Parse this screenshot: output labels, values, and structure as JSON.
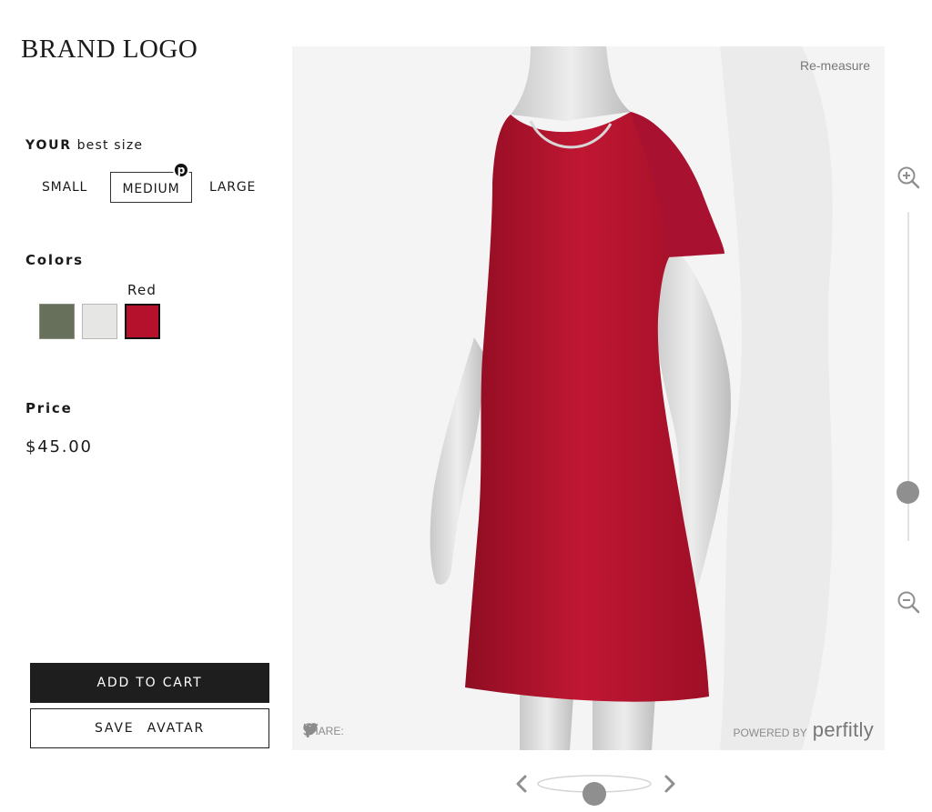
{
  "brand": {
    "logo_text": "BRAND LOGO"
  },
  "size": {
    "heading_bold": "YOUR",
    "heading_rest": "best size",
    "options": [
      "SMALL",
      "MEDIUM",
      "LARGE"
    ],
    "selected": "MEDIUM",
    "badge": "p"
  },
  "colors": {
    "heading": "Colors",
    "selected_name": "Red",
    "swatches": [
      {
        "name": "olive",
        "hex": "#67705a"
      },
      {
        "name": "heather-grey",
        "hex": "#e6e6e4"
      },
      {
        "name": "Red",
        "hex": "#b5112c"
      }
    ]
  },
  "price": {
    "heading": "Price",
    "value": "$45.00"
  },
  "actions": {
    "add_to_cart": "ADD TO CART",
    "save_avatar": "SAVE   AVATAR"
  },
  "viewer": {
    "remeasure": "Re-measure",
    "share_label": "SHARE:",
    "share_icons": [
      "facebook-icon",
      "twitter-icon",
      "pinterest-icon"
    ],
    "powered_by": "POWERED BY",
    "powered_logo": "perfitly",
    "dress_color": "#b5112c",
    "zoom_level": 0.15,
    "rotation_position": 0.5
  }
}
